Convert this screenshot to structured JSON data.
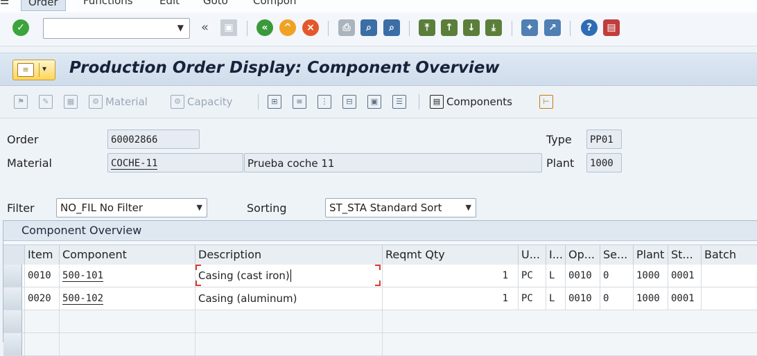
{
  "menu": {
    "items": [
      "Order",
      "Functions",
      "Edit",
      "Goto",
      "Compon"
    ]
  },
  "toolbar": {
    "command_value": "",
    "colors": {
      "enter": "#3ca43c",
      "back": "#3a9a3a",
      "exit": "#f0a224",
      "cancel": "#e2572b",
      "help": "#2e6db5"
    }
  },
  "title": "Production Order Display: Component Overview",
  "app_toolbar": {
    "material_label": "Material",
    "capacity_label": "Capacity",
    "components_label": "Components"
  },
  "header": {
    "order_label": "Order",
    "order_value": "60002866",
    "material_label": "Material",
    "material_value": "COCHE-11",
    "material_desc": "Prueba coche 11",
    "type_label": "Type",
    "type_value": "PP01",
    "plant_label": "Plant",
    "plant_value": "1000"
  },
  "filter": {
    "label": "Filter",
    "value": "NO_FIL No Filter"
  },
  "sorting": {
    "label": "Sorting",
    "value": "ST_STA Standard Sort"
  },
  "table": {
    "title": "Component Overview",
    "columns": [
      "Item",
      "Component",
      "Description",
      "Reqmt Qty",
      "U...",
      "I...",
      "Op...",
      "Se...",
      "Plant",
      "St...",
      "Batch"
    ],
    "rows": [
      [
        "0010",
        "500-101",
        "Casing  (cast iron)",
        "1",
        "PC",
        "L",
        "0010",
        "0",
        "1000",
        "0001",
        ""
      ],
      [
        "0020",
        "500-102",
        "Casing  (aluminum)",
        "1",
        "PC",
        "L",
        "0010",
        "0",
        "1000",
        "0001",
        ""
      ]
    ]
  }
}
